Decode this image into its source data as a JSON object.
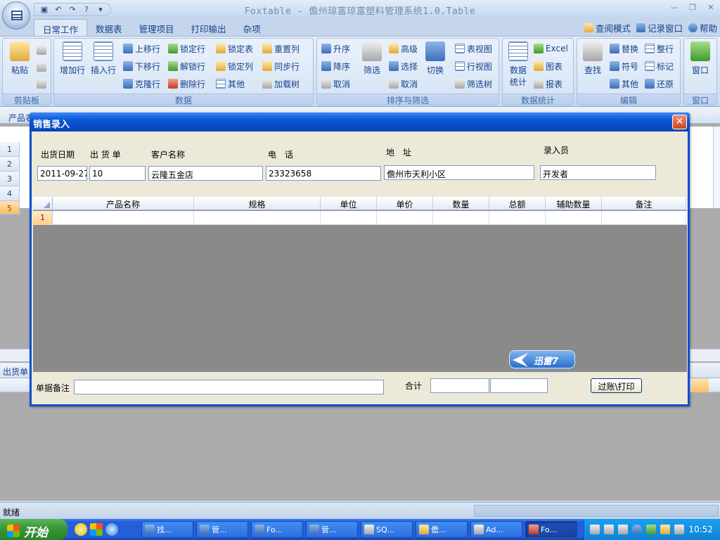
{
  "app": {
    "title": "Foxtable - 儋州琼富琼富塑料管理系统1.0.Table"
  },
  "qat": [
    "save-icon",
    "undo-icon",
    "redo-icon",
    "help-icon"
  ],
  "tabs": [
    "日常工作",
    "数据表",
    "管理项目",
    "打印输出",
    "杂项"
  ],
  "right_links": [
    "查阅模式",
    "记录窗口",
    "帮助"
  ],
  "ribbon": {
    "clipboard": {
      "label": "剪贴板",
      "paste": "粘贴"
    },
    "data": {
      "label": "数据",
      "add_row": "增加行",
      "insert_row": "插入行",
      "move_up": "上移行",
      "move_down": "下移行",
      "clone_row": "克隆行",
      "lock_row": "锁定行",
      "unlock_row": "解锁行",
      "delete_row": "删除行",
      "lock_table": "锁定表",
      "lock_col": "锁定列",
      "other": "其他",
      "reset_col": "重置列",
      "sync_row": "同步行",
      "load_tree": "加载树"
    },
    "sort_filter": {
      "label": "排序与筛选",
      "asc": "升序",
      "desc": "降序",
      "cancel": "取消",
      "filter": "筛选",
      "advanced": "高级",
      "select": "选择",
      "cancel2": "取消",
      "switch": "切换",
      "table_view": "表视图",
      "row_view": "行视图",
      "filter_tree": "筛选树"
    },
    "stats": {
      "label": "数据统计",
      "data_stats_1": "数据",
      "data_stats_2": "统计",
      "excel": "Excel",
      "chart": "图表",
      "report": "报表"
    },
    "edit": {
      "label": "编辑",
      "find": "查找",
      "replace": "替换",
      "symbol": "符号",
      "other": "其他",
      "whole_row": "整行",
      "mark": "标记",
      "restore": "还原"
    },
    "window": {
      "label": "窗口",
      "window": "窗口"
    }
  },
  "workspace": {
    "table_label": "产品表",
    "rows": [
      "1",
      "2",
      "3",
      "4",
      "5"
    ],
    "bottom_tab": "出货单"
  },
  "dialog": {
    "title": "销售录入",
    "fields": {
      "date_label": "出货日期",
      "date_value": "2011-09-27",
      "order_label": "出 货 单",
      "order_value": "10",
      "customer_label": "客户名称",
      "customer_value": "云隆五金店",
      "phone_label": "电　话",
      "phone_value": "23323658",
      "address_label": "地　址",
      "address_value": "儋州市天利小区",
      "operator_label": "录入员",
      "operator_value": "开发者"
    },
    "grid": {
      "columns": [
        "产品名称",
        "规格",
        "单位",
        "单价",
        "数量",
        "总额",
        "辅助数量",
        "备注"
      ],
      "rows": [
        "1"
      ]
    },
    "note_label": "单据备注",
    "note_value": "",
    "total_label": "合计",
    "total_1": "",
    "total_2": "",
    "print_button": "过账\\打印",
    "badge": "迅雷7"
  },
  "status": {
    "text": "就绪"
  },
  "taskbar": {
    "start": "开始",
    "tasks": [
      "找...",
      "管...",
      "Fo...",
      "管...",
      "SQ...",
      "儋...",
      "Ad...",
      "Fo..."
    ],
    "clock": "10:52"
  }
}
